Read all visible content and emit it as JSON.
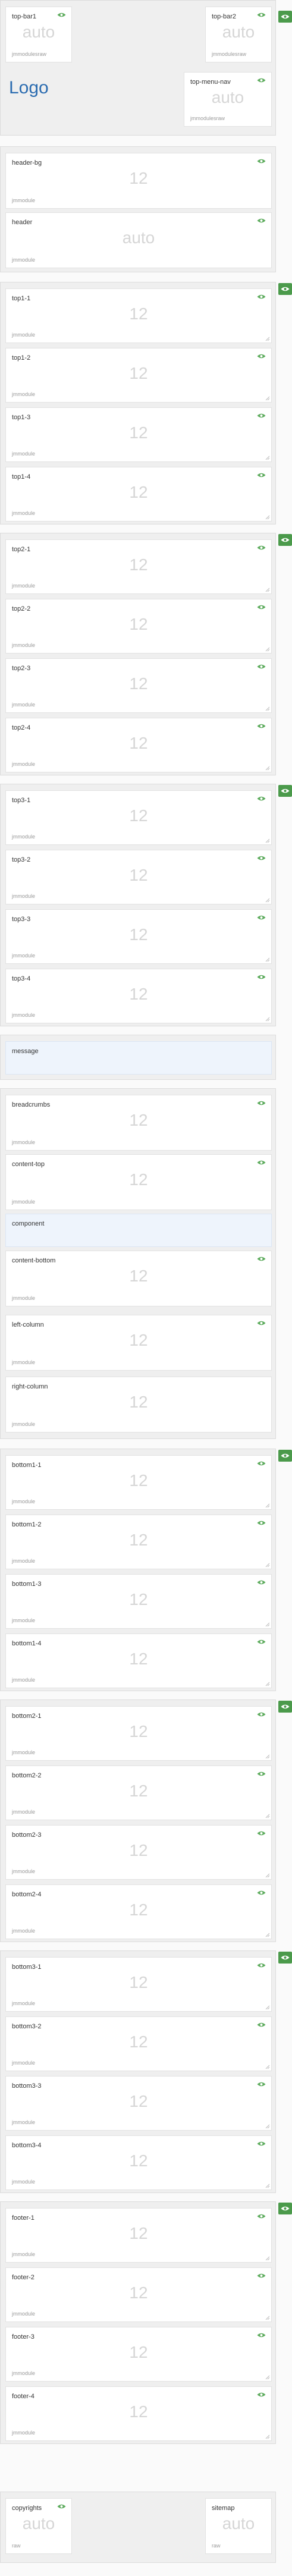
{
  "accent_color": "#4b9a4b",
  "eye_icon": "eye-icon",
  "header_section": {
    "logo_text": "Logo",
    "top_bar1": {
      "name": "top-bar1",
      "value": "auto",
      "style": "jmmodulesraw"
    },
    "top_bar2": {
      "name": "top-bar2",
      "value": "auto",
      "style": "jmmodulesraw"
    },
    "top_menu_nav": {
      "name": "top-menu-nav",
      "value": "auto",
      "style": "jmmodulesraw"
    }
  },
  "header_bg_section": {
    "header_bg": {
      "name": "header-bg",
      "value": "12",
      "style": "jmmodule"
    },
    "header": {
      "name": "header",
      "value": "auto",
      "style": "jmmodule"
    }
  },
  "top1": [
    {
      "name": "top1-1",
      "value": "12",
      "style": "jmmodule"
    },
    {
      "name": "top1-2",
      "value": "12",
      "style": "jmmodule"
    },
    {
      "name": "top1-3",
      "value": "12",
      "style": "jmmodule"
    },
    {
      "name": "top1-4",
      "value": "12",
      "style": "jmmodule"
    }
  ],
  "top2": [
    {
      "name": "top2-1",
      "value": "12",
      "style": "jmmodule"
    },
    {
      "name": "top2-2",
      "value": "12",
      "style": "jmmodule"
    },
    {
      "name": "top2-3",
      "value": "12",
      "style": "jmmodule"
    },
    {
      "name": "top2-4",
      "value": "12",
      "style": "jmmodule"
    }
  ],
  "top3": [
    {
      "name": "top3-1",
      "value": "12",
      "style": "jmmodule"
    },
    {
      "name": "top3-2",
      "value": "12",
      "style": "jmmodule"
    },
    {
      "name": "top3-3",
      "value": "12",
      "style": "jmmodule"
    },
    {
      "name": "top3-4",
      "value": "12",
      "style": "jmmodule"
    }
  ],
  "message": {
    "name": "message"
  },
  "main": {
    "breadcrumbs": {
      "name": "breadcrumbs",
      "value": "12",
      "style": "jmmodule"
    },
    "content_top": {
      "name": "content-top",
      "value": "12",
      "style": "jmmodule"
    },
    "component": {
      "name": "component"
    },
    "content_bottom": {
      "name": "content-bottom",
      "value": "12",
      "style": "jmmodule"
    },
    "left_column": {
      "name": "left-column",
      "value": "12",
      "style": "jmmodule"
    },
    "right_column": {
      "name": "right-column",
      "value": "12",
      "style": "jmmodule"
    }
  },
  "bottom1": [
    {
      "name": "bottom1-1",
      "value": "12",
      "style": "jmmodule"
    },
    {
      "name": "bottom1-2",
      "value": "12",
      "style": "jmmodule"
    },
    {
      "name": "bottom1-3",
      "value": "12",
      "style": "jmmodule"
    },
    {
      "name": "bottom1-4",
      "value": "12",
      "style": "jmmodule"
    }
  ],
  "bottom2": [
    {
      "name": "bottom2-1",
      "value": "12",
      "style": "jmmodule"
    },
    {
      "name": "bottom2-2",
      "value": "12",
      "style": "jmmodule"
    },
    {
      "name": "bottom2-3",
      "value": "12",
      "style": "jmmodule"
    },
    {
      "name": "bottom2-4",
      "value": "12",
      "style": "jmmodule"
    }
  ],
  "bottom3": [
    {
      "name": "bottom3-1",
      "value": "12",
      "style": "jmmodule"
    },
    {
      "name": "bottom3-2",
      "value": "12",
      "style": "jmmodule"
    },
    {
      "name": "bottom3-3",
      "value": "12",
      "style": "jmmodule"
    },
    {
      "name": "bottom3-4",
      "value": "12",
      "style": "jmmodule"
    }
  ],
  "footer": [
    {
      "name": "footer-1",
      "value": "12",
      "style": "jmmodule"
    },
    {
      "name": "footer-2",
      "value": "12",
      "style": "jmmodule"
    },
    {
      "name": "footer-3",
      "value": "12",
      "style": "jmmodule"
    },
    {
      "name": "footer-4",
      "value": "12",
      "style": "jmmodule"
    }
  ],
  "copyright_section": {
    "copyrights": {
      "name": "copyrights",
      "value": "auto",
      "style": "raw"
    },
    "sitemap": {
      "name": "sitemap",
      "value": "auto",
      "style": "raw"
    }
  }
}
